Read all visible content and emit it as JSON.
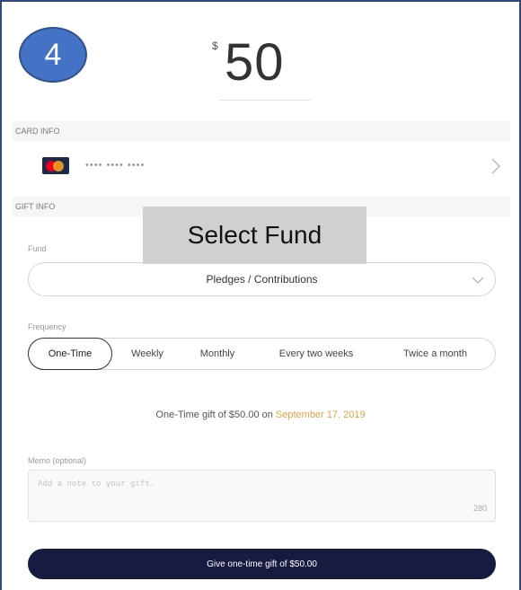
{
  "step": {
    "number": "4"
  },
  "amount": {
    "currency": "$",
    "value": "50"
  },
  "card_info": {
    "header": "CARD INFO",
    "masked_number": "•••• •••• ••••"
  },
  "gift_info": {
    "header": "GIFT INFO",
    "overlay_label": "Select Fund",
    "fund_label": "Fund",
    "fund_value": "Pledges / Contributions",
    "frequency_label": "Frequency",
    "frequency_options": [
      "One-Time",
      "Weekly",
      "Monthly",
      "Every two weeks",
      "Twice a month"
    ],
    "frequency_selected": "One-Time"
  },
  "summary": {
    "prefix": "One-Time gift of $50.00 on ",
    "date": "September 17, 2019"
  },
  "memo": {
    "label": "Memo (optional)",
    "placeholder": "Add a note to your gift.",
    "char_limit": "280"
  },
  "submit": {
    "label": "Give one-time gift of $50.00"
  },
  "colors": {
    "badge": "#4472c4",
    "button": "#161c3f",
    "date_accent": "#e8a040",
    "section_bg": "#f5f6f8"
  }
}
